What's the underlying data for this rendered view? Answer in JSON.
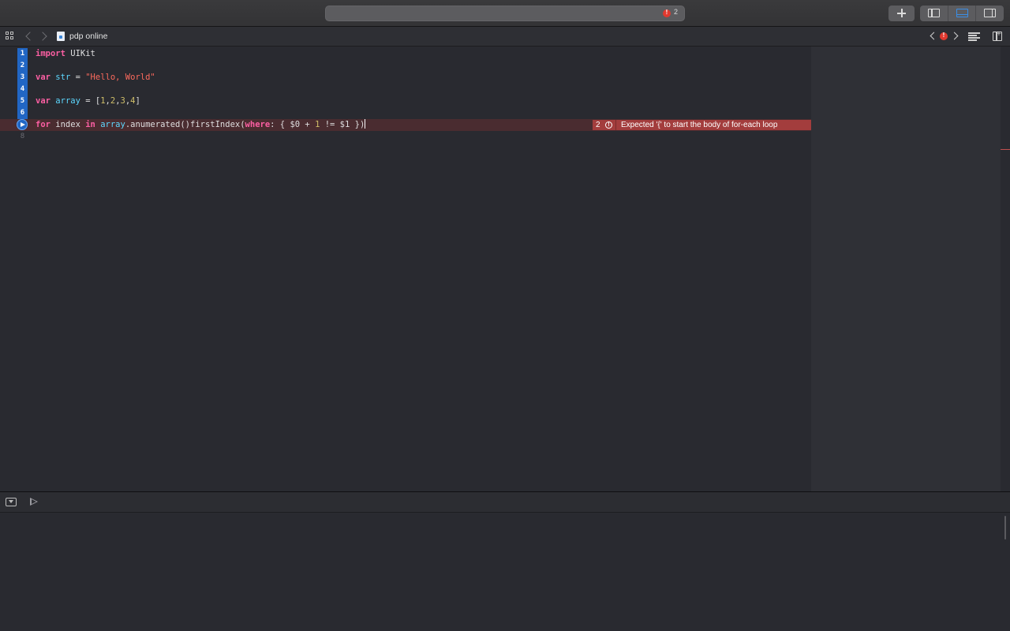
{
  "toolbar": {
    "activity_error_count": "2"
  },
  "jumpbar": {
    "file_name": "pdp online"
  },
  "editor": {
    "lines": [
      {
        "number": "1",
        "tokens": [
          {
            "t": "kw",
            "v": "import"
          },
          {
            "t": "plain",
            "v": " UIKit"
          }
        ]
      },
      {
        "number": "2",
        "tokens": []
      },
      {
        "number": "3",
        "tokens": [
          {
            "t": "kw",
            "v": "var"
          },
          {
            "t": "plain",
            "v": " "
          },
          {
            "t": "ty",
            "v": "str"
          },
          {
            "t": "plain",
            "v": " = "
          },
          {
            "t": "str",
            "v": "\"Hello, World\""
          }
        ]
      },
      {
        "number": "4",
        "tokens": []
      },
      {
        "number": "5",
        "tokens": [
          {
            "t": "kw",
            "v": "var"
          },
          {
            "t": "plain",
            "v": " "
          },
          {
            "t": "ty",
            "v": "array"
          },
          {
            "t": "plain",
            "v": " = ["
          },
          {
            "t": "num",
            "v": "1"
          },
          {
            "t": "plain",
            "v": ","
          },
          {
            "t": "num",
            "v": "2"
          },
          {
            "t": "plain",
            "v": ","
          },
          {
            "t": "num",
            "v": "3"
          },
          {
            "t": "plain",
            "v": ","
          },
          {
            "t": "num",
            "v": "4"
          },
          {
            "t": "plain",
            "v": "]"
          }
        ]
      },
      {
        "number": "6",
        "tokens": []
      },
      {
        "number": "7",
        "tokens": [
          {
            "t": "kw",
            "v": "for"
          },
          {
            "t": "plain",
            "v": " index "
          },
          {
            "t": "kw",
            "v": "in"
          },
          {
            "t": "plain",
            "v": " "
          },
          {
            "t": "ty",
            "v": "array"
          },
          {
            "t": "plain",
            "v": ".anumerated()firstIndex("
          },
          {
            "t": "kw",
            "v": "where"
          },
          {
            "t": "plain",
            "v": ": { $0 + "
          },
          {
            "t": "num",
            "v": "1"
          },
          {
            "t": "plain",
            "v": " != $1 })"
          }
        ]
      },
      {
        "number": "8",
        "tokens": []
      }
    ],
    "error": {
      "line": "7",
      "count": "2",
      "message": "Expected '{' to start the body of for-each loop"
    }
  },
  "colors": {
    "keyword": "#fc5fa3",
    "type": "#5dd8ff",
    "string": "#fc6a5d",
    "number": "#d0bf69",
    "error_bg": "#a33d3d",
    "run_gutter": "#2166c4"
  },
  "icons": {
    "toolbar": [
      "error-icon",
      "add-icon",
      "navigator-panel-icon",
      "debug-panel-icon",
      "inspector-panel-icon"
    ],
    "jumpbar": [
      "related-items-grid-icon",
      "back-icon",
      "forward-icon",
      "swift-file-icon",
      "previous-issue-icon",
      "issue-error-icon",
      "next-issue-icon",
      "editor-options-icon",
      "add-editor-icon"
    ],
    "debug": [
      "hide-debug-area-icon",
      "run-icon"
    ]
  }
}
